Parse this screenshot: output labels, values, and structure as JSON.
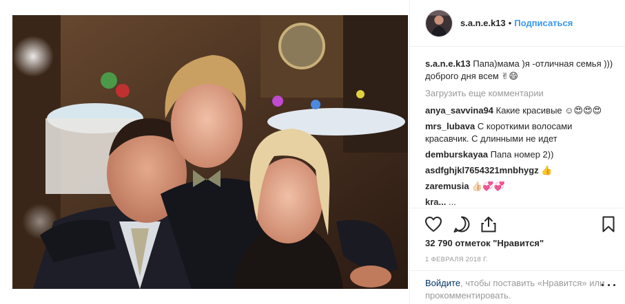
{
  "post": {
    "username": "s.a.n.e.k13",
    "separator": "•",
    "follow_label": "Подписаться",
    "caption": {
      "user": "s.a.n.e.k13",
      "text": "Папа)мама )я -отличная семья ))) доброго дня всем ✌😄"
    },
    "load_more": "Загрузить еще комментарии",
    "comments": [
      {
        "user": "anya_savvina94",
        "text": "Какие красивые ☺😍😍😍"
      },
      {
        "user": "mrs_lubava",
        "text": "С короткими волосами красавчик. С длинными не идет"
      },
      {
        "user": "demburskayaa",
        "text": "Папа номер 2))"
      },
      {
        "user": "asdfghjkl7654321mnbhygz",
        "text": "👍"
      },
      {
        "user": "zaremusia",
        "text": "👍🏻💞💞"
      },
      {
        "user": "kra...",
        "text": "..."
      }
    ],
    "likes": "32 790 отметок \"Нравится\"",
    "date": "1 февраля 2018 г.",
    "login": {
      "link": "Войдите",
      "text": ", чтобы поставить «Нравится» или прокомментировать."
    }
  },
  "icons": {
    "like": "heart-icon",
    "comment": "comment-bubble-icon",
    "share": "share-icon",
    "save": "bookmark-icon",
    "more": "more-options-icon"
  },
  "colors": {
    "link_blue": "#3897f0",
    "text": "#262626",
    "muted": "#999999",
    "login_link": "#003569",
    "border": "#efefef"
  }
}
